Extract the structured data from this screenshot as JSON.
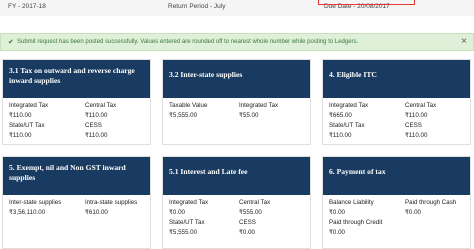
{
  "header": {
    "fy": "FY - 2017-18",
    "return_period": "Return Period - July",
    "due_date": "Due Date - 20/08/2017"
  },
  "alert": {
    "message": "Submit request has been posted successfully. Values entered are rounded off to nearest whole number while posting to Ledgers.",
    "close": "×"
  },
  "tiles": {
    "outward": {
      "title": "3.1 Tax on outward and reverse charge inward supplies",
      "l1": "Integrated Tax",
      "v1": "₹110.00",
      "l2": "Central Tax",
      "v2": "₹110.00",
      "l3": "State/UT Tax",
      "v3": "₹110.00",
      "l4": "CESS",
      "v4": "₹110.00"
    },
    "interstate": {
      "title": "3.2 Inter-state supplies",
      "l1": "Taxable Value",
      "v1": "₹5,555.00",
      "l2": "Integrated Tax",
      "v2": "₹55.00"
    },
    "itc": {
      "title": "4. Eligible ITC",
      "l1": "Integrated Tax",
      "v1": "₹665.00",
      "l2": "Central Tax",
      "v2": "₹110.00",
      "l3": "State/UT Tax",
      "v3": "₹110.00",
      "l4": "CESS",
      "v4": "₹110.00"
    },
    "exempt": {
      "title": "5. Exempt, nil and Non GST inward supplies",
      "l1": "Inter-state supplies",
      "v1": "₹3,56,110.00",
      "l2": "Intra-state supplies",
      "v2": "₹610.00"
    },
    "interest": {
      "title": "5.1 Interest and Late fee",
      "l1": "Integrated Tax",
      "v1": "₹0.00",
      "l2": "Central Tax",
      "v2": "₹555.00",
      "l3": "State/UT Tax",
      "v3": "₹5,555.00",
      "l4": "CESS",
      "v4": "₹0.00"
    },
    "payment": {
      "title": "6. Payment of tax",
      "l1": "Balance Liability",
      "v1": "₹0.00",
      "l2": "Paid through Cash",
      "v2": "₹0.00",
      "l3": "Paid through Credit",
      "v3": "₹0.00"
    }
  }
}
